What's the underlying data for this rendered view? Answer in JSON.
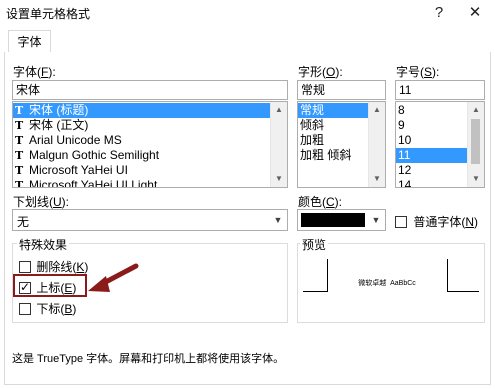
{
  "window": {
    "title": "设置单元格格式",
    "help_icon": "?",
    "close_icon": "✕"
  },
  "tabs": [
    {
      "label": "字体"
    }
  ],
  "font": {
    "label_prefix": "字体(",
    "label_key": "F",
    "label_suffix": "):",
    "value": "宋体",
    "items": [
      {
        "label": "宋体 (标题)",
        "selected": true
      },
      {
        "label": "宋体 (正文)",
        "selected": false
      },
      {
        "label": "Arial Unicode MS",
        "selected": false
      },
      {
        "label": "Malgun Gothic Semilight",
        "selected": false
      },
      {
        "label": "Microsoft YaHei UI",
        "selected": false
      },
      {
        "label": "Microsoft YaHei UI Light",
        "selected": false
      }
    ],
    "item_icon": "T"
  },
  "style": {
    "label_prefix": "字形(",
    "label_key": "O",
    "label_suffix": "):",
    "value": "常规",
    "items": [
      {
        "label": "常规",
        "selected": true
      },
      {
        "label": "倾斜",
        "selected": false
      },
      {
        "label": "加粗",
        "selected": false
      },
      {
        "label": "加粗 倾斜",
        "selected": false
      }
    ]
  },
  "size": {
    "label_prefix": "字号(",
    "label_key": "S",
    "label_suffix": "):",
    "value": "11",
    "items": [
      {
        "label": "8",
        "selected": false
      },
      {
        "label": "9",
        "selected": false
      },
      {
        "label": "10",
        "selected": false
      },
      {
        "label": "11",
        "selected": true
      },
      {
        "label": "12",
        "selected": false
      },
      {
        "label": "14",
        "selected": false
      }
    ]
  },
  "underline": {
    "label_prefix": "下划线(",
    "label_key": "U",
    "label_suffix": "):",
    "value": "无"
  },
  "color": {
    "label_prefix": "颜色(",
    "label_key": "C",
    "label_suffix": "):",
    "swatch": "#000000"
  },
  "normal_font": {
    "label_prefix": "普通字体(",
    "label_key": "N",
    "label_suffix": ")",
    "checked": false
  },
  "effects": {
    "title": "特殊效果",
    "strikethrough": {
      "prefix": "删除线(",
      "key": "K",
      "suffix": ")",
      "checked": false
    },
    "superscript": {
      "prefix": "上标(",
      "key": "E",
      "suffix": ")",
      "checked": true
    },
    "subscript": {
      "prefix": "下标(",
      "key": "B",
      "suffix": ")",
      "checked": false
    }
  },
  "preview": {
    "title": "预览",
    "sample": "微软卓越  AaBbCc"
  },
  "footer": {
    "note": "这是 TrueType 字体。屏幕和打印机上都将使用该字体。"
  },
  "annotation": {
    "highlight_color": "#8b1a1a",
    "arrow_color": "#8b1a1a"
  }
}
